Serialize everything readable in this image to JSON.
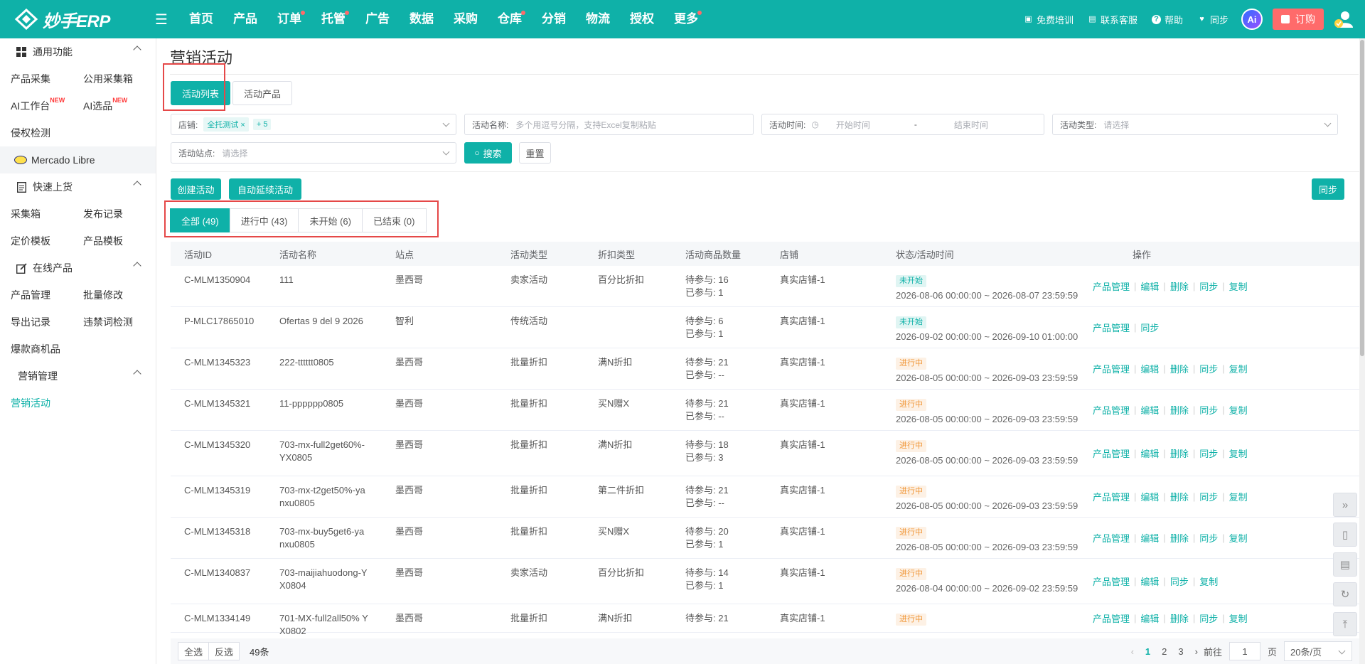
{
  "brand": {
    "name": "妙手ERP"
  },
  "nav": [
    "首页",
    "产品",
    "订单",
    "托管",
    "广告",
    "数据",
    "采购",
    "仓库",
    "分销",
    "物流",
    "授权",
    "更多"
  ],
  "nav_dots": [
    false,
    false,
    true,
    true,
    false,
    false,
    false,
    true,
    false,
    false,
    false,
    true
  ],
  "top_right": {
    "training": "免费培训",
    "contact": "联系客服",
    "help": "帮助",
    "sync": "同步",
    "ai": "Ai",
    "order": "订购"
  },
  "sidebar": {
    "general": "通用功能",
    "general_items": [
      [
        "产品采集",
        "公用采集箱"
      ],
      [
        "AI工作台",
        "AI选品"
      ],
      [
        "侵权检测",
        ""
      ]
    ],
    "new_tag": "NEW",
    "mercado": "Mercado Libre",
    "quick": "快速上货",
    "quick_items": [
      [
        "采集箱",
        "发布记录"
      ],
      [
        "定价模板",
        "产品模板"
      ]
    ],
    "online": "在线产品",
    "online_items": [
      [
        "产品管理",
        "批量修改"
      ],
      [
        "导出记录",
        "违禁词检测"
      ],
      [
        "爆款商机品",
        ""
      ]
    ],
    "marketing": "营销管理",
    "marketing_active": "营销活动"
  },
  "page": {
    "title": "营销活动",
    "tab_list": "活动列表",
    "tab_products": "活动产品"
  },
  "filters": {
    "shop_label": "店铺:",
    "shop_tag": "全托测试",
    "shop_more": "+ 5",
    "name_label": "活动名称:",
    "name_placeholder": "多个用逗号分隔，支持Excel复制粘贴",
    "time_label": "活动时间:",
    "time_start": "开始时间",
    "time_dash": "-",
    "time_end": "结束时间",
    "type_label": "活动类型:",
    "type_placeholder": "请选择",
    "site_label": "活动站点:",
    "site_placeholder": "请选择",
    "search": "搜索",
    "reset": "重置"
  },
  "actions": {
    "create": "创建活动",
    "auto_extend": "自动延续活动",
    "sync": "同步"
  },
  "status_tabs": [
    "全部 (49)",
    "进行中 (43)",
    "未开始 (6)",
    "已结束 (0)"
  ],
  "table": {
    "headers": [
      "活动ID",
      "活动名称",
      "站点",
      "活动类型",
      "折扣类型",
      "活动商品数量",
      "店铺",
      "状态/活动时间",
      "操作"
    ],
    "rows": [
      {
        "id": "C-MLM1350904",
        "name": "111",
        "site": "墨西哥",
        "type": "卖家活动",
        "discount": "百分比折扣",
        "pending": "待参与: 16",
        "joined": "已参与: 1",
        "shop": "真实店铺-1",
        "status": "未开始",
        "time": "2026-08-06 00:00:00 ~ 2026-08-07 23:59:59",
        "ops": [
          "产品管理",
          "编辑",
          "删除",
          "同步",
          "复制"
        ]
      },
      {
        "id": "P-MLC17865010",
        "name": "Ofertas 9 del 9 2026",
        "site": "智利",
        "type": "传统活动",
        "discount": "",
        "pending": "待参与: 6",
        "joined": "已参与: 1",
        "shop": "真实店铺-1",
        "status": "未开始",
        "time": "2026-09-02 00:00:00 ~ 2026-09-10 01:00:00",
        "ops": [
          "产品管理",
          "同步"
        ]
      },
      {
        "id": "C-MLM1345323",
        "name": "222-tttttt0805",
        "site": "墨西哥",
        "type": "批量折扣",
        "discount": "满N折扣",
        "pending": "待参与: 21",
        "joined": "已参与: --",
        "shop": "真实店铺-1",
        "status": "进行中",
        "time": "2026-08-05 00:00:00 ~ 2026-09-03 23:59:59",
        "ops": [
          "产品管理",
          "编辑",
          "删除",
          "同步",
          "复制"
        ]
      },
      {
        "id": "C-MLM1345321",
        "name": "11-pppppp0805",
        "site": "墨西哥",
        "type": "批量折扣",
        "discount": "买N赠X",
        "pending": "待参与: 21",
        "joined": "已参与: --",
        "shop": "真实店铺-1",
        "status": "进行中",
        "time": "2026-08-05 00:00:00 ~ 2026-09-03 23:59:59",
        "ops": [
          "产品管理",
          "编辑",
          "删除",
          "同步",
          "复制"
        ]
      },
      {
        "id": "C-MLM1345320",
        "name": "703-mx-full2get60%-YX0805",
        "site": "墨西哥",
        "type": "批量折扣",
        "discount": "满N折扣",
        "pending": "待参与: 18",
        "joined": "已参与: 3",
        "shop": "真实店铺-1",
        "status": "进行中",
        "time": "2026-08-05 00:00:00 ~ 2026-09-03 23:59:59",
        "ops": [
          "产品管理",
          "编辑",
          "删除",
          "同步",
          "复制"
        ]
      },
      {
        "id": "C-MLM1345319",
        "name": "703-mx-t2get50%-yanxu0805",
        "site": "墨西哥",
        "type": "批量折扣",
        "discount": "第二件折扣",
        "pending": "待参与: 21",
        "joined": "已参与: --",
        "shop": "真实店铺-1",
        "status": "进行中",
        "time": "2026-08-05 00:00:00 ~ 2026-09-03 23:59:59",
        "ops": [
          "产品管理",
          "编辑",
          "删除",
          "同步",
          "复制"
        ]
      },
      {
        "id": "C-MLM1345318",
        "name": "703-mx-buy5get6-yanxu0805",
        "site": "墨西哥",
        "type": "批量折扣",
        "discount": "买N赠X",
        "pending": "待参与: 20",
        "joined": "已参与: 1",
        "shop": "真实店铺-1",
        "status": "进行中",
        "time": "2026-08-05 00:00:00 ~ 2026-09-03 23:59:59",
        "ops": [
          "产品管理",
          "编辑",
          "删除",
          "同步",
          "复制"
        ]
      },
      {
        "id": "C-MLM1340837",
        "name": "703-maijiahuodong-YX0804",
        "site": "墨西哥",
        "type": "卖家活动",
        "discount": "百分比折扣",
        "pending": "待参与: 14",
        "joined": "已参与: 1",
        "shop": "真实店铺-1",
        "status": "进行中",
        "time": "2026-08-04 00:00:00 ~ 2026-09-02 23:59:59",
        "ops": [
          "产品管理",
          "编辑",
          "同步",
          "复制"
        ]
      },
      {
        "id": "C-MLM1334149",
        "name": "701-MX-full2all50% YX0802",
        "site": "墨西哥",
        "type": "批量折扣",
        "discount": "满N折扣",
        "pending": "待参与: 21",
        "joined": "",
        "shop": "真实店铺-1",
        "status": "进行中",
        "time": "",
        "ops": [
          "产品管理",
          "编辑",
          "删除",
          "同步",
          "复制"
        ]
      }
    ]
  },
  "footer": {
    "select_all": "全选",
    "invert": "反选",
    "count": "49条",
    "pages": [
      "1",
      "2",
      "3"
    ],
    "goto": "前往",
    "page_input": "1",
    "page_unit": "页",
    "page_size": "20条/页"
  }
}
